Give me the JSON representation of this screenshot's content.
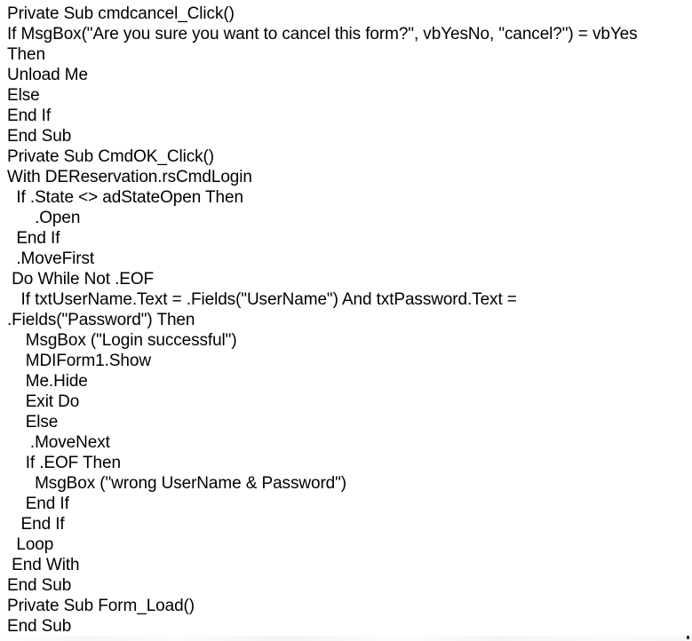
{
  "document": {
    "kind": "code-listing",
    "language": "Visual Basic",
    "text_color": "#000000",
    "background_color": "#ffffff",
    "lines": [
      "Private Sub cmdcancel_Click()",
      "If MsgBox(\"Are you sure you want to cancel this form?\", vbYesNo, \"cancel?\") = vbYes",
      "Then",
      "Unload Me",
      "Else",
      "End If",
      "End Sub",
      "Private Sub CmdOK_Click()",
      "With DEReservation.rsCmdLogin",
      "  If .State <> adStateOpen Then",
      "      .Open",
      "  End If",
      "  .MoveFirst",
      " Do While Not .EOF",
      "   If txtUserName.Text = .Fields(\"UserName\") And txtPassword.Text =",
      ".Fields(\"Password\") Then",
      "    MsgBox (\"Login successful\")",
      "    MDIForm1.Show",
      "    Me.Hide",
      "    Exit Do",
      "    Else",
      "     .MoveNext",
      "    If .EOF Then",
      "      MsgBox (\"wrong UserName & Password\")",
      "    End If",
      "   End If",
      "  Loop",
      " End With",
      "End Sub",
      "Private Sub Form_Load()",
      "End Sub"
    ]
  }
}
